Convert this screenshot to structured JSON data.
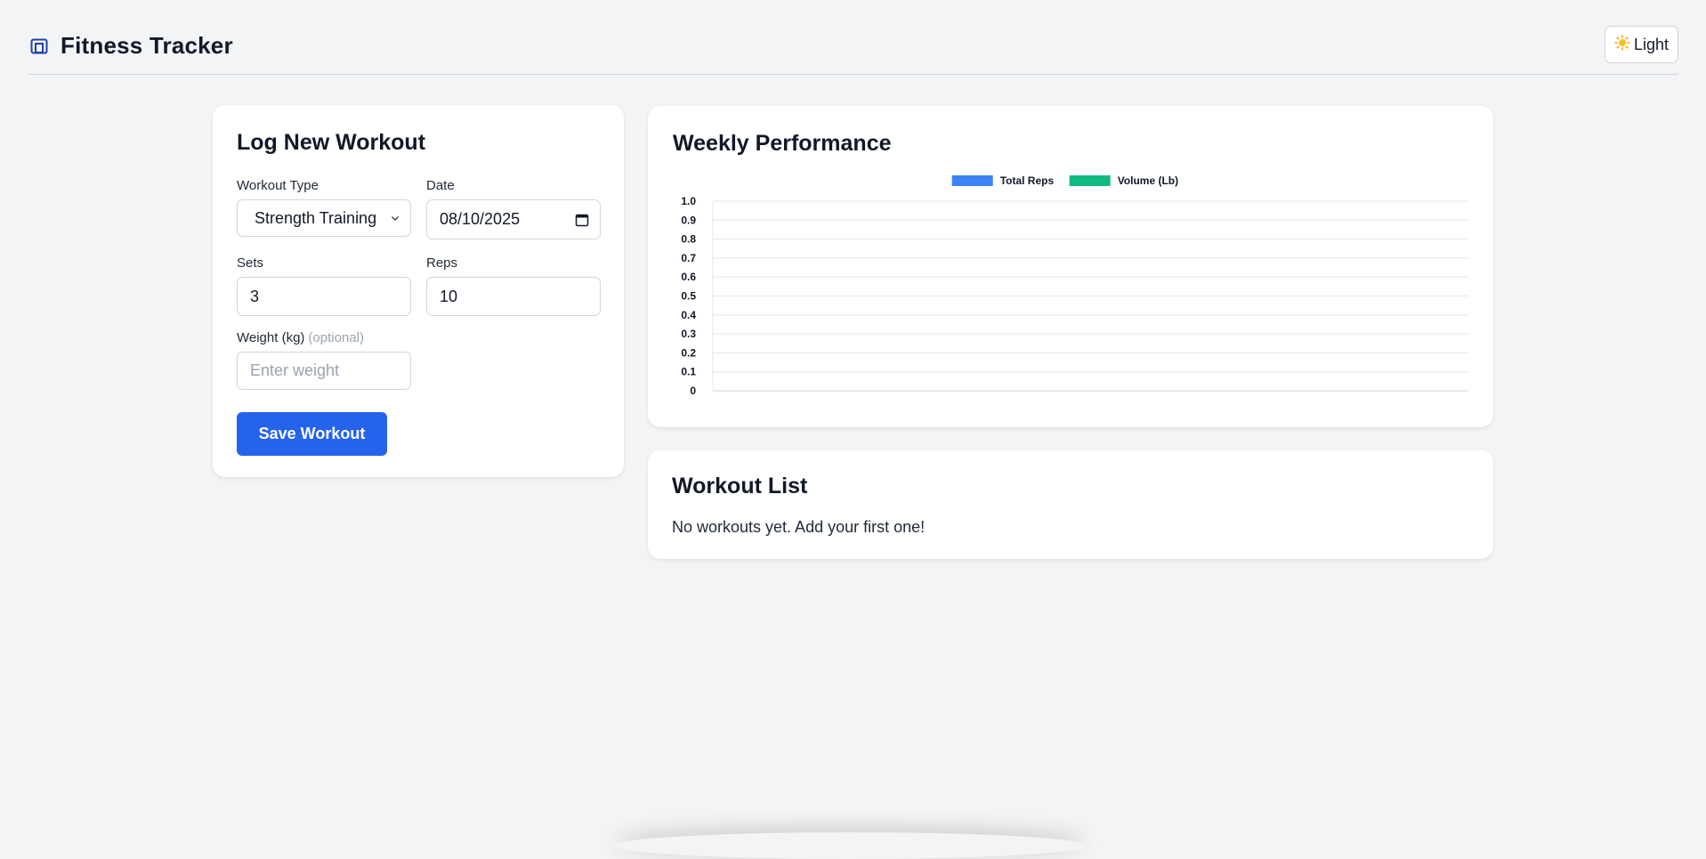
{
  "app": {
    "title": "Fitness Tracker",
    "icon": "dumbbell-box-icon",
    "theme_button": {
      "icon": "sun-icon",
      "label": "Light"
    }
  },
  "log_form": {
    "title": "Log New Workout",
    "workout_type": {
      "label": "Workout Type",
      "value": "Strength Training"
    },
    "date": {
      "label": "Date",
      "value": "08/10/2025"
    },
    "sets": {
      "label": "Sets",
      "value": "3"
    },
    "reps": {
      "label": "Reps",
      "value": "10"
    },
    "weight": {
      "label": "Weight (kg)",
      "optional_label": "(optional)",
      "placeholder": "Enter weight",
      "value": ""
    },
    "save_label": "Save Workout"
  },
  "performance": {
    "title": "Weekly Performance"
  },
  "chart_data": {
    "type": "bar",
    "categories": [],
    "series": [
      {
        "name": "Total Reps",
        "values": [],
        "color": "#3b82f6"
      },
      {
        "name": "Volume (Lb)",
        "values": [],
        "color": "#10b981"
      }
    ],
    "yticks": [
      "1.0",
      "0.9",
      "0.8",
      "0.7",
      "0.6",
      "0.5",
      "0.4",
      "0.3",
      "0.2",
      "0.1",
      "0"
    ],
    "ylim": [
      0,
      1
    ],
    "grid": true,
    "legend_position": "top-center"
  },
  "workout_list": {
    "title": "Workout List",
    "empty_message": "No workouts yet. Add your first one!"
  },
  "colors": {
    "accent": "#2563eb",
    "background": "#f3f4f6",
    "card": "#ffffff"
  }
}
